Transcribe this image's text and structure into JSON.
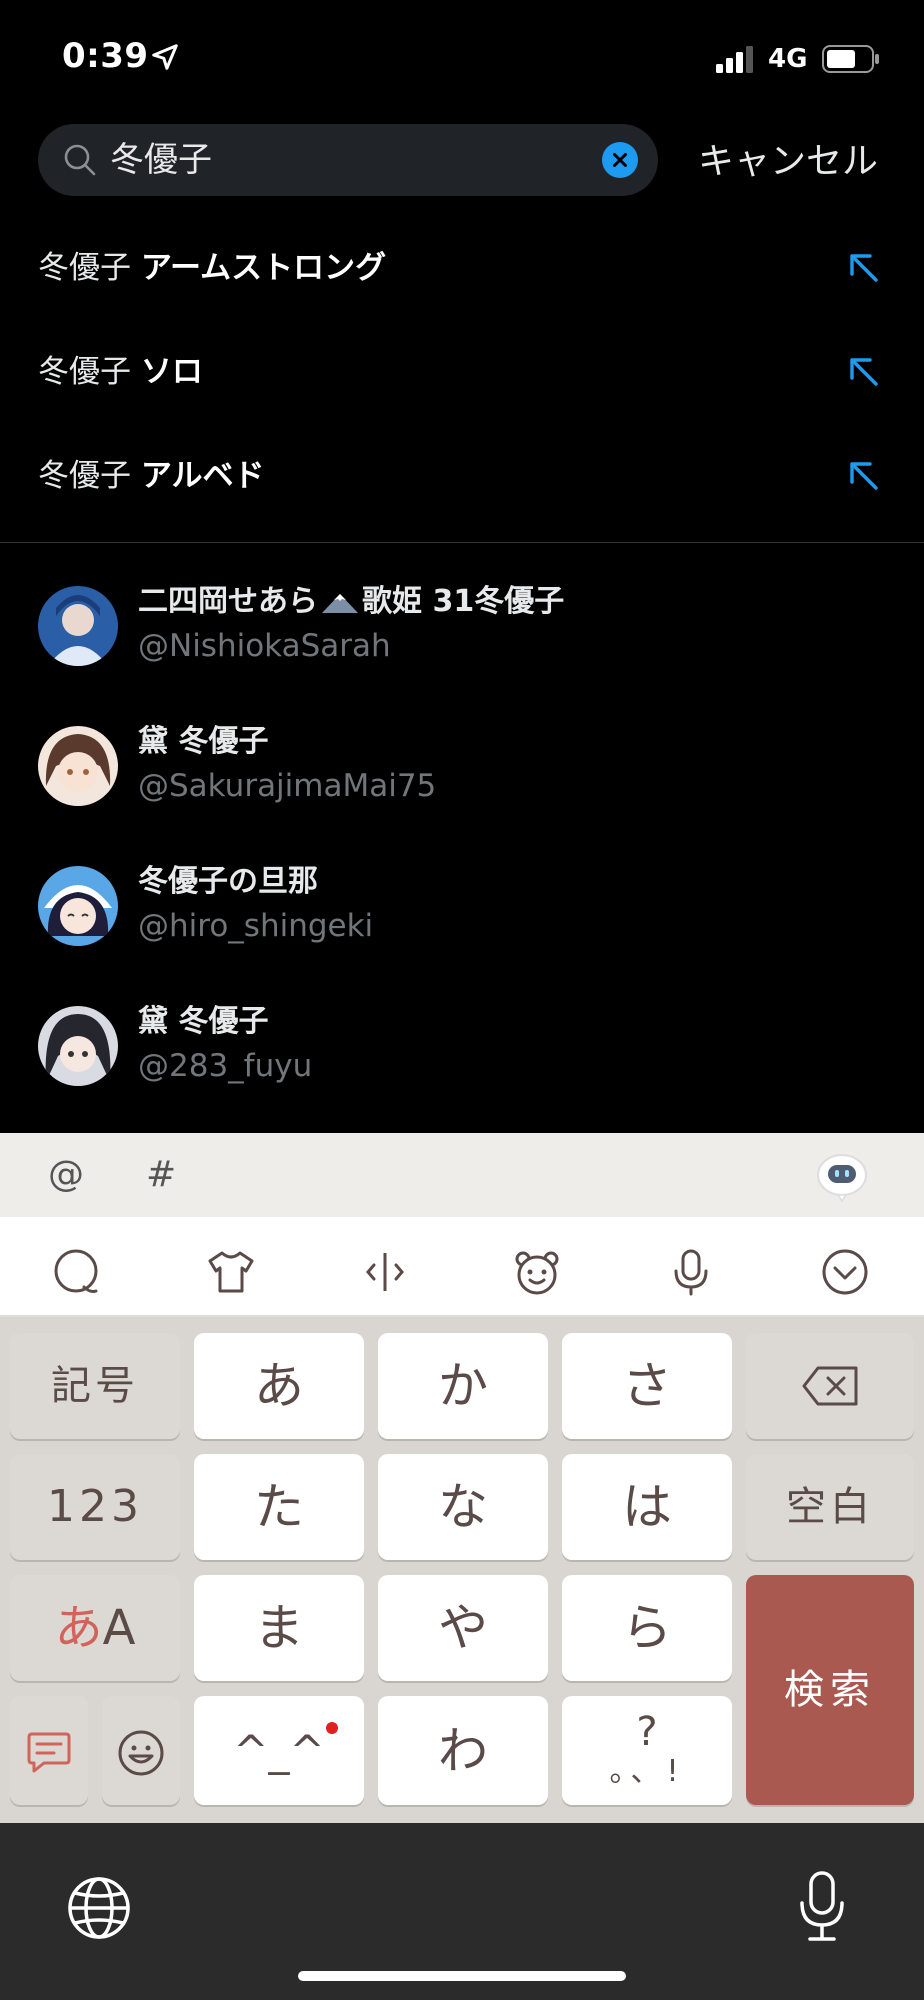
{
  "status": {
    "time": "0:39",
    "network": "4G"
  },
  "search": {
    "query": "冬優子",
    "cancel_label": "キャンセル"
  },
  "suggestions": [
    {
      "prefix": "冬優子",
      "suffix": "アームストロング"
    },
    {
      "prefix": "冬優子",
      "suffix": "ソロ"
    },
    {
      "prefix": "冬優子",
      "suffix": "アルベド"
    }
  ],
  "users": [
    {
      "name_a": "二四岡せあら",
      "name_b": "歌姫 31冬優子",
      "handle": "@NishiokaSarah"
    },
    {
      "name_a": "黛 冬優子",
      "name_b": "",
      "handle": "@SakurajimaMai75"
    },
    {
      "name_a": "冬優子の旦那",
      "name_b": "",
      "handle": "@hiro_shingeki"
    },
    {
      "name_a": "黛 冬優子",
      "name_b": "",
      "handle": "@283_fuyu"
    }
  ],
  "keyboard": {
    "toolbar": {
      "at": "@",
      "hash": "#"
    },
    "keys": {
      "kigou": "記号",
      "a": "あ",
      "ka": "か",
      "sa": "さ",
      "num": "123",
      "ta": "た",
      "na": "な",
      "ha": "は",
      "space": "空白",
      "aA_a": "あ",
      "aA_A": "A",
      "ma": "ま",
      "ya": "や",
      "ra": "ら",
      "search": "検索",
      "kaomoji": "^_^",
      "wa": "わ",
      "punct_top": "?",
      "punct_bottom": "。、!"
    }
  },
  "colors": {
    "accent": "#1d9bf0",
    "search_key": "#a9594f",
    "kana_red": "#d0645a"
  }
}
